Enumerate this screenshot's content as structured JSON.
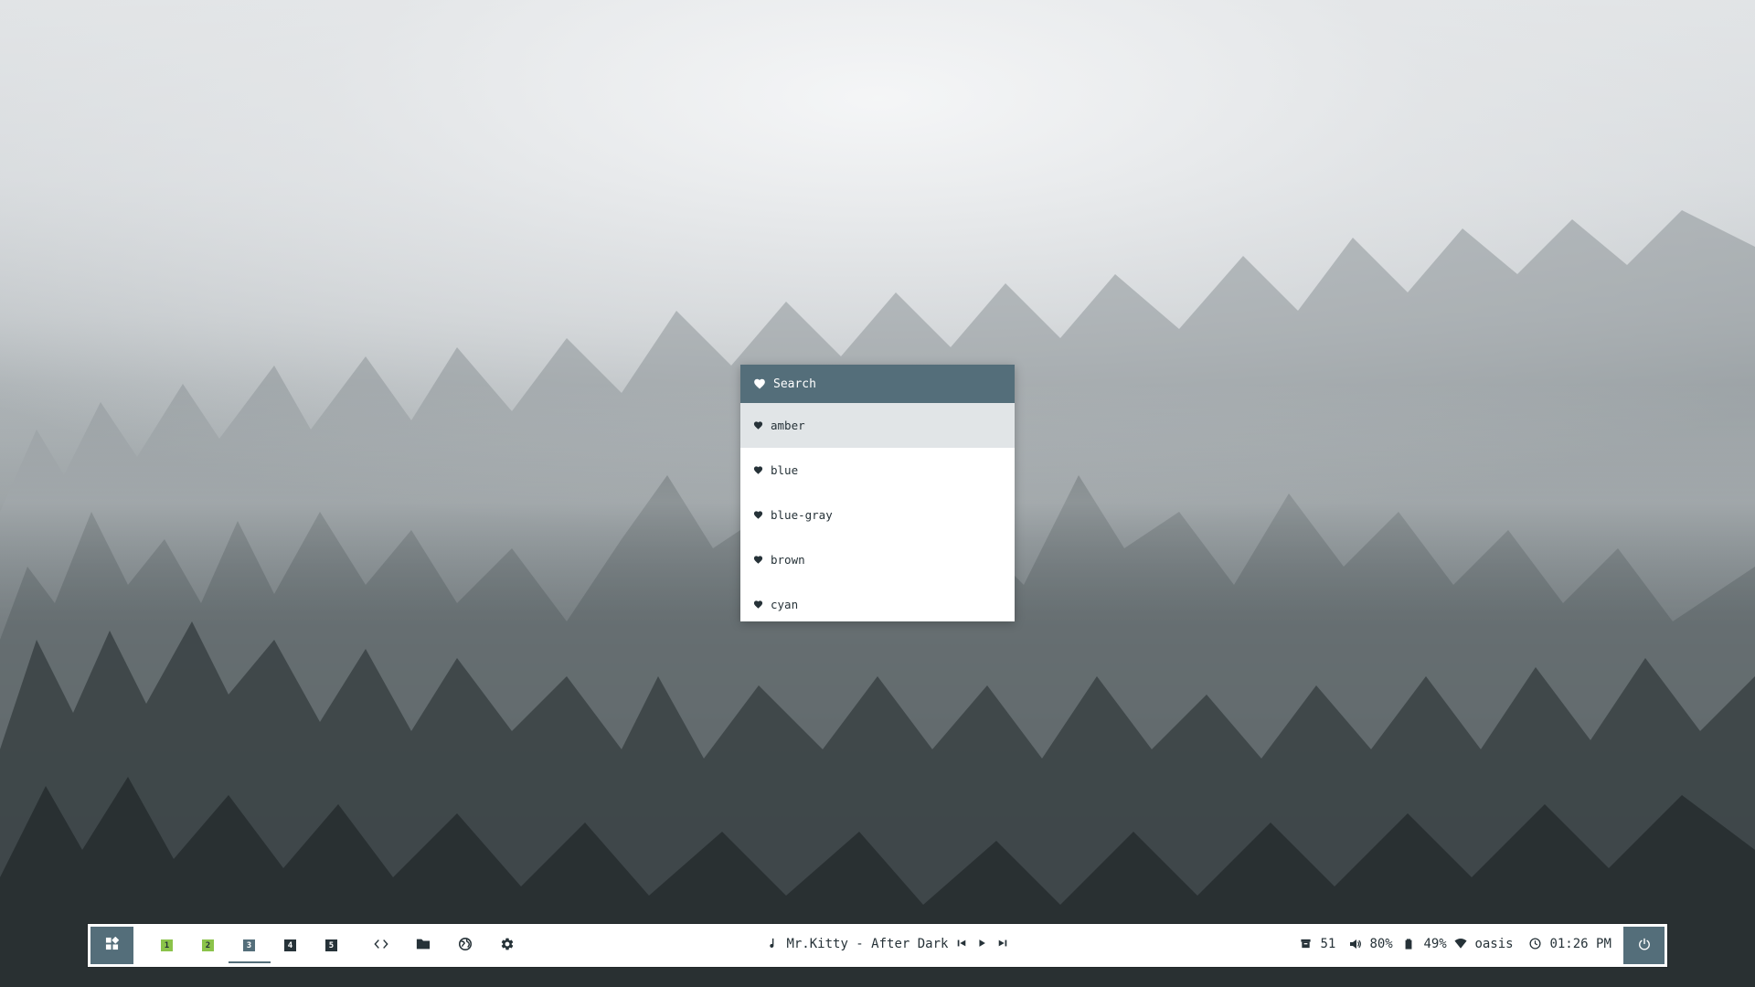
{
  "launcher": {
    "search_label": "Search",
    "items": [
      {
        "label": "amber"
      },
      {
        "label": "blue"
      },
      {
        "label": "blue-gray"
      },
      {
        "label": "brown"
      },
      {
        "label": "cyan"
      }
    ],
    "active_index": 0
  },
  "taskbar": {
    "workspaces": [
      {
        "label": "1",
        "state": "occupied"
      },
      {
        "label": "2",
        "state": "occupied"
      },
      {
        "label": "3",
        "state": "focused"
      },
      {
        "label": "4",
        "state": "empty"
      },
      {
        "label": "5",
        "state": "empty"
      }
    ],
    "apps": [
      {
        "icon": "code-icon"
      },
      {
        "icon": "folder-icon"
      },
      {
        "icon": "globe-icon"
      },
      {
        "icon": "gear-icon"
      }
    ],
    "music": {
      "track": "Mr.Kitty - After Dark",
      "icons": [
        "music-note-icon",
        "previous-icon",
        "play-icon",
        "next-icon"
      ]
    },
    "status": {
      "archive_count": "51",
      "volume": "80%",
      "battery": "49%",
      "network": "oasis",
      "time": "01:26 PM"
    }
  },
  "colors": {
    "accent": "#546e7a",
    "workspace_occupied": "#8bc34a",
    "text": "#263238",
    "highlight": "#e1e5e7"
  }
}
